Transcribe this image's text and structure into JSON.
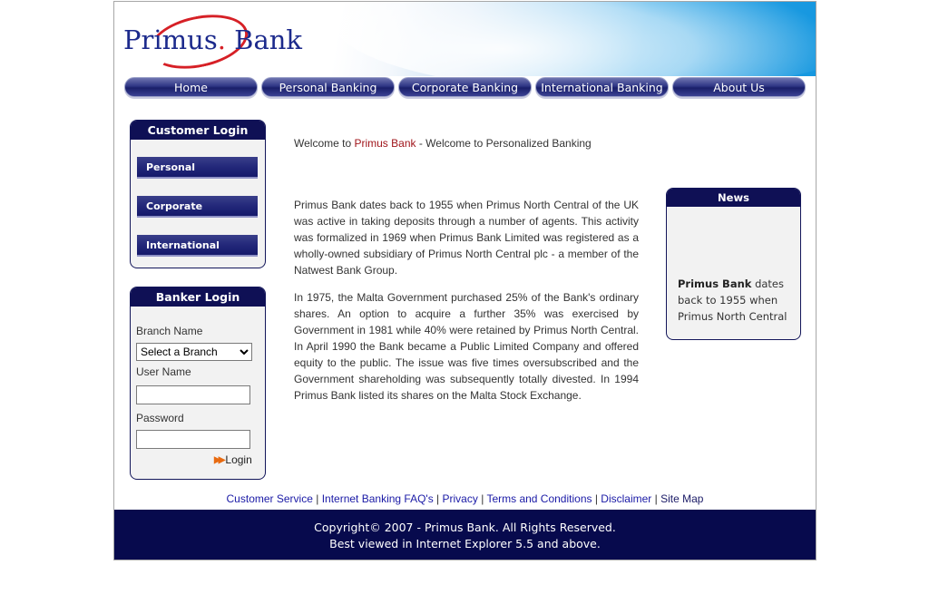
{
  "logo": {
    "word": "Primus",
    "dot": ".",
    "word2": " Bank"
  },
  "nav": [
    "Home",
    "Personal Banking",
    "Corporate Banking",
    "International Banking",
    "About Us"
  ],
  "customer_login": {
    "title": "Customer Login",
    "buttons": [
      "Personal",
      "Corporate",
      "International"
    ]
  },
  "banker_login": {
    "title": "Banker Login",
    "branch_label": "Branch Name",
    "branch_selected": "Select a Branch",
    "user_label": "User Name",
    "password_label": "Password",
    "login_label": "Login"
  },
  "welcome": {
    "prefix": "Welcome to ",
    "brand": "Primus Bank",
    "suffix": " - Welcome to Personalized Banking"
  },
  "paragraphs": [
    "Primus Bank dates back to 1955 when Primus North Central of the UK was active in taking deposits through a number of agents. This activity was formalized in 1969 when Primus Bank Limited was registered as a wholly-owned subsidiary of Primus North Central plc - a member of the Natwest Bank Group.",
    "In 1975, the Malta Government purchased 25% of the Bank's ordinary shares. An option to acquire a further 35% was exercised by Government in 1981 while 40% were retained by Primus North Central. In April 1990 the Bank became a Public Limited Company and offered equity to the public. The issue was five times oversubscribed and the Government shareholding was subsequently totally divested. In 1994 Primus Bank listed its shares on the Malta Stock Exchange."
  ],
  "news": {
    "title": "News",
    "bold": "Primus Bank",
    "text": " dates back to 1955 when Primus North Central"
  },
  "footer_links": [
    "Customer Service",
    "Internet Banking FAQ's",
    "Privacy",
    "Terms and Conditions",
    "Disclaimer",
    "Site Map"
  ],
  "footer": {
    "copyright": "Copyright© 2007 - Primus Bank. All Rights Reserved.",
    "note": "Best viewed in Internet Explorer 5.5 and above."
  }
}
